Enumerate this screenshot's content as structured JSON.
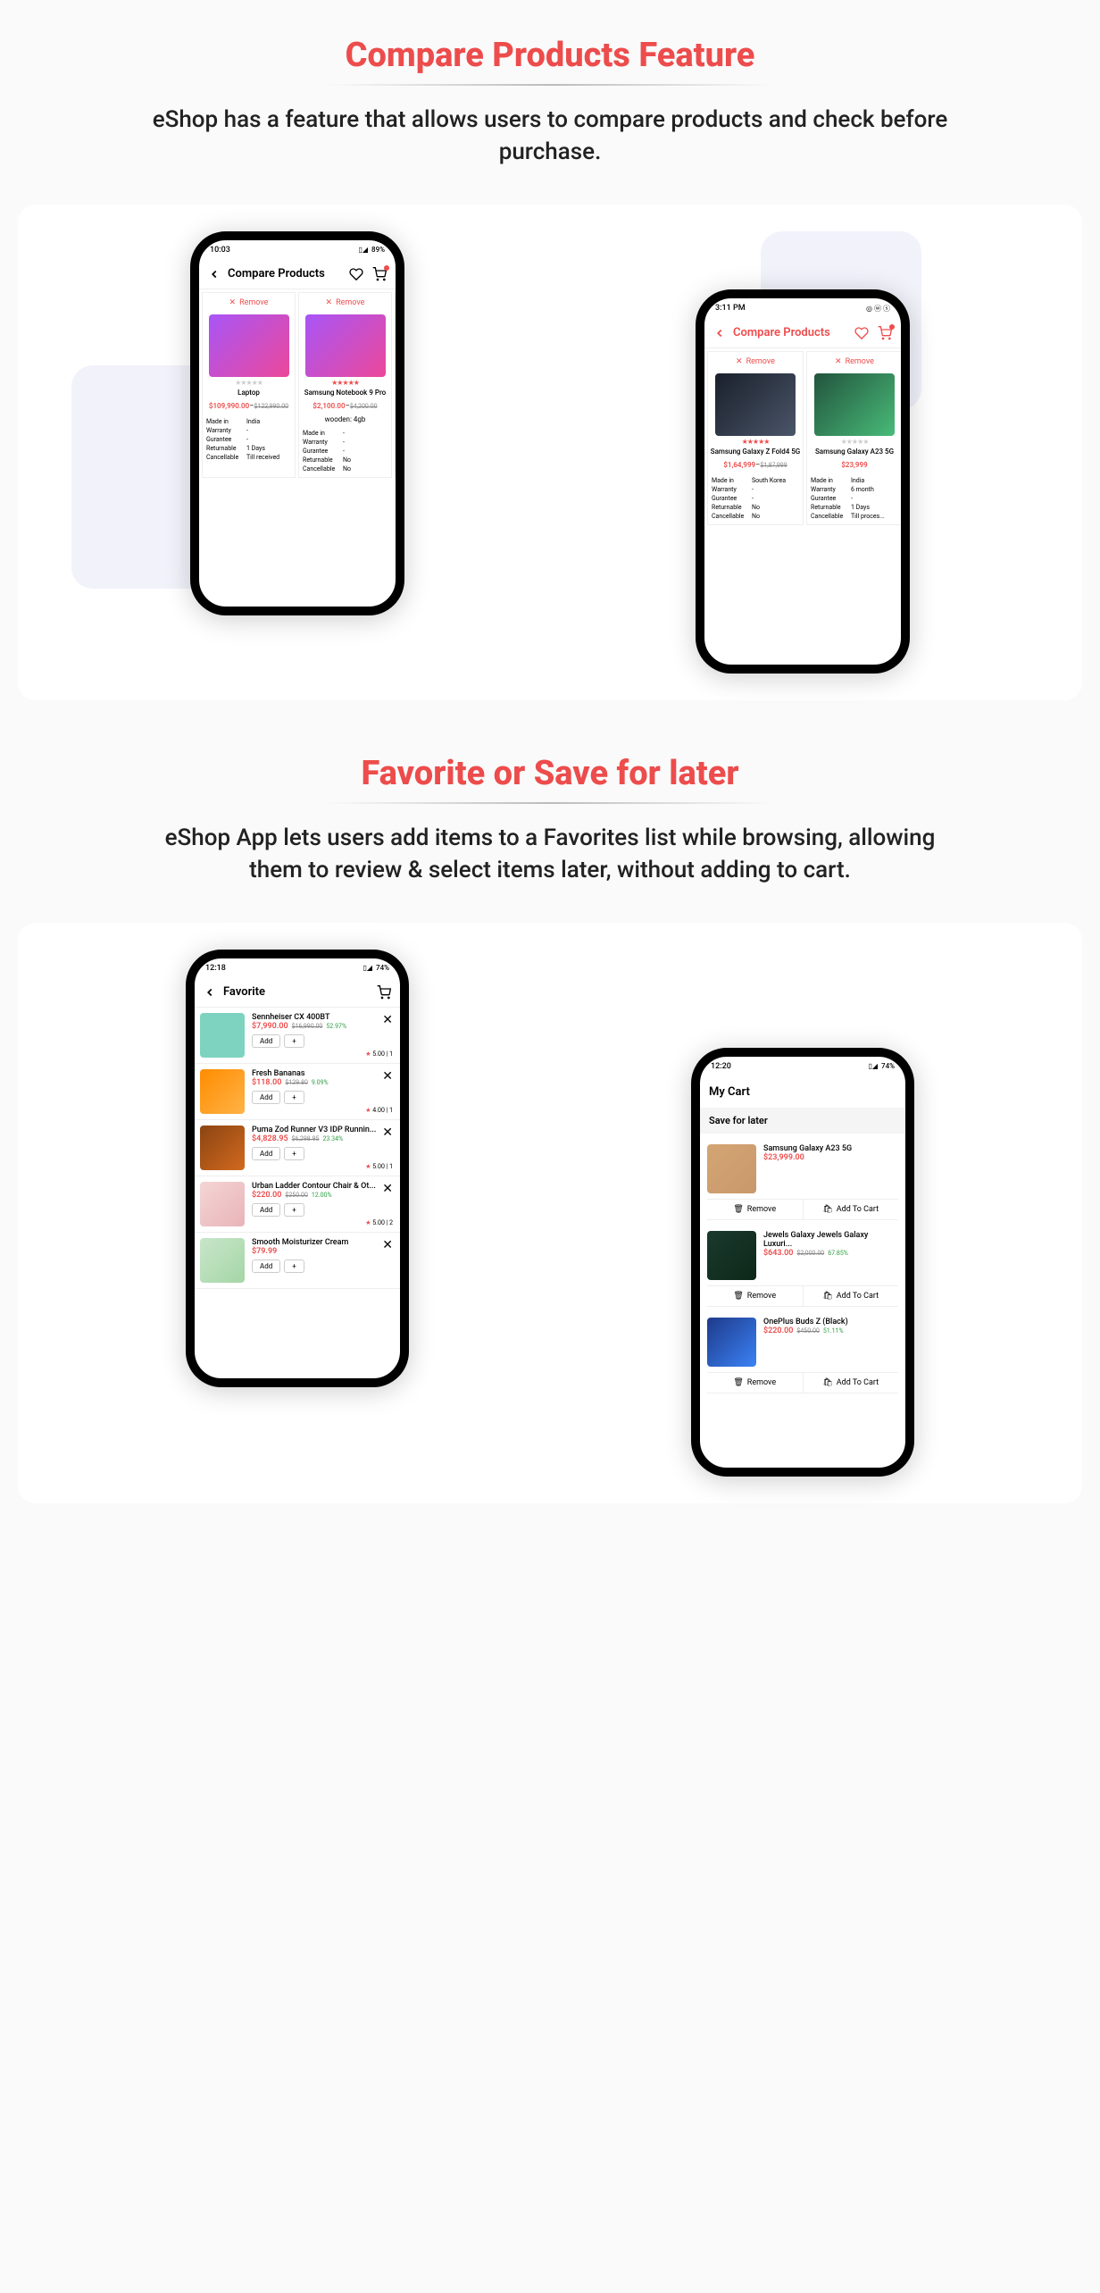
{
  "section1": {
    "title": "Compare Products Feature",
    "subtitle": "eShop has a feature that allows users to compare products and check before purchase."
  },
  "phone1": {
    "time": "10:03",
    "battery": "89%",
    "header": "Compare Products",
    "remove": "Remove",
    "products": [
      {
        "name": "Laptop",
        "stars_empty": true,
        "price": "$109,990.00",
        "old": "$122,990.00",
        "specs": {
          "made_in": "India",
          "warranty": "-",
          "gurantee": "-",
          "returnable": "1 Days",
          "cancellable": "Till received"
        }
      },
      {
        "name": "Samsung Notebook 9 Pro",
        "stars_empty": false,
        "price": "$2,100.00",
        "old": "$4,200.00",
        "variant": "wooden: 4gb",
        "specs": {
          "made_in": "-",
          "warranty": "-",
          "gurantee": "-",
          "returnable": "No",
          "cancellable": "No"
        }
      }
    ],
    "spec_labels": {
      "made_in": "Made in",
      "warranty": "Warranty",
      "gurantee": "Gurantee",
      "returnable": "Returnable",
      "cancellable": "Cancellable"
    }
  },
  "phone2": {
    "time": "3:11 PM",
    "header": "Compare Products",
    "remove": "Remove",
    "products": [
      {
        "name": "Samsung Galaxy Z Fold4 5G",
        "stars_empty": false,
        "price": "$1,64,999",
        "old": "$1,87,999",
        "specs": {
          "made_in": "South Korea",
          "warranty": "-",
          "gurantee": "-",
          "returnable": "No",
          "cancellable": "No"
        }
      },
      {
        "name": "Samsung Galaxy A23 5G",
        "stars_empty": true,
        "price": "$23,999",
        "old": "",
        "specs": {
          "made_in": "India",
          "warranty": "6 month",
          "gurantee": "-",
          "returnable": "1 Days",
          "cancellable": "Till proces..."
        }
      }
    ]
  },
  "section2": {
    "title": "Favorite or Save for later",
    "subtitle": "eShop App lets users add items to a Favorites list while browsing, allowing them to review & select items later, without adding to cart."
  },
  "phone3": {
    "time": "12:18",
    "battery": "74%",
    "header": "Favorite",
    "add_label": "Add",
    "items": [
      {
        "name": "Sennheiser CX 400BT",
        "price": "$7,990.00",
        "old": "$16,990.00",
        "disc": "52.97%",
        "rating": "5.00 | 1",
        "thumb": "th-teal"
      },
      {
        "name": "Fresh Bananas",
        "price": "$118.00",
        "old": "$129.80",
        "disc": "9.09%",
        "rating": "4.00 | 1",
        "thumb": "th-orange"
      },
      {
        "name": "Puma Zod Runner V3 IDP Runnin...",
        "price": "$4,828.95",
        "old": "$6,298.95",
        "disc": "23.34%",
        "rating": "5.00 | 1",
        "thumb": "th-brown"
      },
      {
        "name": "Urban Ladder Contour Chair & Ot...",
        "price": "$220.00",
        "old": "$250.00",
        "disc": "12.00%",
        "rating": "5.00 | 2",
        "thumb": "th-pink"
      },
      {
        "name": "Smooth Moisturizer Cream",
        "price": "$79.99",
        "old": "",
        "disc": "",
        "rating": "",
        "thumb": "th-green"
      }
    ]
  },
  "phone4": {
    "time": "12:20",
    "battery": "74%",
    "cart_title": "My Cart",
    "section_title": "Save for later",
    "remove": "Remove",
    "add_to_cart": "Add To Cart",
    "items": [
      {
        "name": "Samsung Galaxy A23 5G",
        "price": "$23,999.00",
        "old": "",
        "disc": "",
        "thumb": "th-gold"
      },
      {
        "name": "Jewels Galaxy Jewels Galaxy Luxuri...",
        "price": "$643.00",
        "old": "$2,000.00",
        "disc": "67.85%",
        "thumb": "th-darkgreen"
      },
      {
        "name": "OnePlus Buds Z (Black)",
        "price": "$220.00",
        "old": "$450.00",
        "disc": "51.11%",
        "thumb": "th-blue"
      }
    ]
  }
}
